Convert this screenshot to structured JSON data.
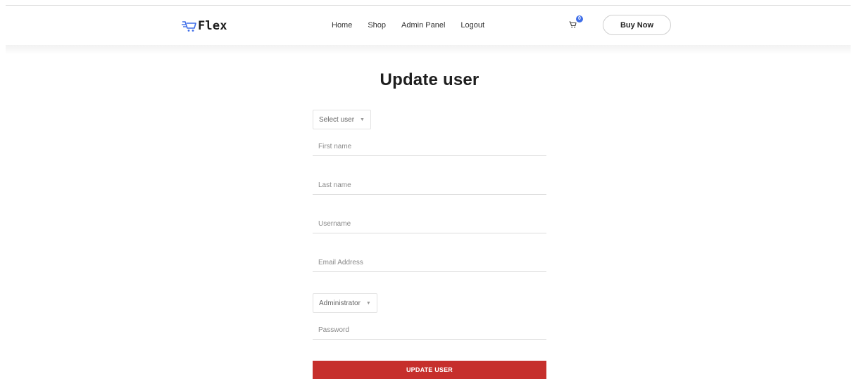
{
  "brand": {
    "name": "Flex",
    "logo_icon": "cart-speed-icon",
    "accent": "#3f6ee8"
  },
  "nav": [
    {
      "label": "Home"
    },
    {
      "label": "Shop"
    },
    {
      "label": "Admin Panel"
    },
    {
      "label": "Logout"
    }
  ],
  "cart": {
    "count": "0",
    "icon": "cart-icon"
  },
  "header": {
    "buy_label": "Buy Now"
  },
  "form": {
    "title": "Update user",
    "user_select": {
      "selected": "Select user"
    },
    "first_name": {
      "placeholder": "First name",
      "value": ""
    },
    "last_name": {
      "placeholder": "Last name",
      "value": ""
    },
    "username": {
      "placeholder": "Username",
      "value": ""
    },
    "email": {
      "placeholder": "Email Address",
      "value": ""
    },
    "role_select": {
      "selected": "Administrator"
    },
    "password": {
      "placeholder": "Password",
      "value": ""
    },
    "submit_label": "UPDATE USER",
    "submit_color": "#c62f2c"
  }
}
